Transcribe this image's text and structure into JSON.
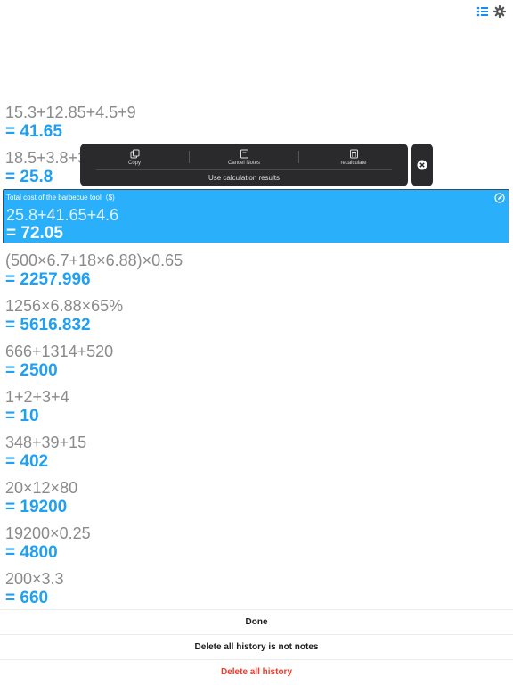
{
  "toolbar": {
    "list_icon": "list-icon",
    "settings_icon": "gear-icon"
  },
  "history": [
    {
      "expression": "15.3+12.85+4.5+9",
      "result": "= 41.65"
    },
    {
      "expression": "18.5+3.8+3.5",
      "result": "= 25.8"
    },
    {
      "expression": "(500×6.7+18×6.88)×0.65",
      "result": "= 2257.996"
    },
    {
      "expression": "1256×6.88×65%",
      "result": "= 5616.832"
    },
    {
      "expression": "666+1314+520",
      "result": "= 2500"
    },
    {
      "expression": "1+2+3+4",
      "result": "= 10"
    },
    {
      "expression": "348+39+15",
      "result": "= 402"
    },
    {
      "expression": "20×12×80",
      "result": "= 19200"
    },
    {
      "expression": "19200×0.25",
      "result": "= 4800"
    },
    {
      "expression": "200×3.3",
      "result": "= 660"
    }
  ],
  "selected": {
    "note": "Total cost of the barbecue tool（$)",
    "expression": "25.8+41.65+4.6",
    "result": "= 72.05"
  },
  "popup": {
    "copy": "Copy",
    "cancel_notes": "Cancel Notes",
    "recalculate": "recalculate",
    "use_results": "Use calculation results"
  },
  "sheet": {
    "done": "Done",
    "delete_not_notes": "Delete all history is not notes",
    "delete_all": "Delete all history"
  },
  "colors": {
    "accent": "#1fa0f2",
    "selected_bg": "#2ab0fb",
    "danger": "#f23a2a",
    "popup_bg": "#2a2a2c"
  }
}
